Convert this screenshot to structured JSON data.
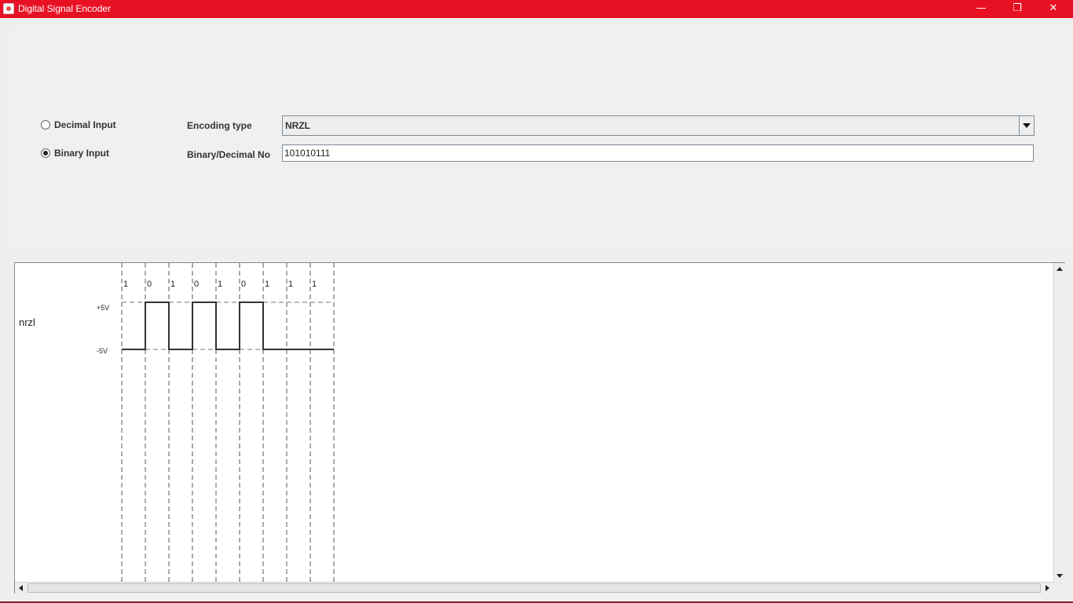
{
  "window": {
    "title": "Digital Signal Encoder",
    "titlebar_color": "#e81123",
    "minimize_glyph": "—",
    "restore_glyph": "❐",
    "close_glyph": "✕"
  },
  "input_mode": {
    "decimal_label": "Decimal Input",
    "binary_label": "Binary Input",
    "selected": "binary"
  },
  "encoding": {
    "label": "Encoding type",
    "selected": "NRZL"
  },
  "number": {
    "label": "Binary/Decimal No",
    "value": "101010111"
  },
  "chart_data": {
    "type": "line",
    "series": [
      {
        "name": "nrzl",
        "bits": [
          "1",
          "0",
          "1",
          "0",
          "1",
          "0",
          "1",
          "1",
          "1"
        ],
        "levels": [
          -5,
          5,
          -5,
          5,
          -5,
          5,
          -5,
          -5,
          -5
        ]
      }
    ],
    "y_tick_labels": [
      "+5V",
      "-5V"
    ],
    "grid": "dashed vertical bit boundaries"
  },
  "icons": {
    "app": "java-app-icon",
    "dropdown": "chevron-down-icon",
    "scroll_up": "arrow-up-icon",
    "scroll_down": "arrow-down-icon",
    "scroll_left": "arrow-left-icon",
    "scroll_right": "arrow-right-icon"
  }
}
